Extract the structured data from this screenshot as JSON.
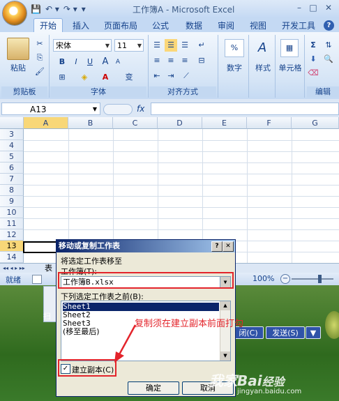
{
  "window": {
    "title": "工作簿A - Microsoft Excel",
    "min": "–",
    "max": "□",
    "close": "✕"
  },
  "qat": {
    "save": "💾",
    "undo": "↶ ▾",
    "redo": "↷ ▾",
    "more": "▾"
  },
  "tabs": [
    {
      "label": "开始",
      "active": true
    },
    {
      "label": "插入"
    },
    {
      "label": "页面布局"
    },
    {
      "label": "公式"
    },
    {
      "label": "数据"
    },
    {
      "label": "审阅"
    },
    {
      "label": "视图"
    },
    {
      "label": "开发工具"
    }
  ],
  "ribbon": {
    "clipboard": {
      "paste": "粘贴",
      "group": "剪贴板"
    },
    "font": {
      "name": "宋体",
      "size": "11",
      "bold": "B",
      "italic": "I",
      "underline": "U",
      "wen": "变",
      "group": "字体",
      "increase": "A",
      "decrease": "A"
    },
    "alignment": {
      "group": "对齐方式"
    },
    "number": {
      "label": "数字",
      "percent": "%"
    },
    "styles": {
      "label": "样式",
      "icon": "A"
    },
    "cells": {
      "label": "单元格"
    },
    "editing": {
      "group": "编辑",
      "sigma": "Σ"
    }
  },
  "formula": {
    "namebox": "A13",
    "fx": "fx",
    "value": ""
  },
  "grid": {
    "columns": [
      "A",
      "B",
      "C",
      "D",
      "E",
      "F",
      "G"
    ],
    "rows": [
      "3",
      "4",
      "5",
      "6",
      "7",
      "8",
      "9",
      "10",
      "11",
      "12",
      "13",
      "14"
    ],
    "selected_row": "13"
  },
  "sheetbar": {
    "nav": "◂◂ ◂ ▸ ▸▸",
    "partial_tab": "表"
  },
  "statusbar": {
    "ready": "就绪",
    "zoom": "100%",
    "zoom_minus": "−",
    "zoom_plus": "+"
  },
  "dialog": {
    "title": "移动或复制工作表",
    "help": "?",
    "close": "✕",
    "move_to": "将选定工作表移至",
    "book_label": "工作簿(T):",
    "book_value": "工作簿B.xlsx",
    "before_label": "下列选定工作表之前(B):",
    "sheets": [
      "Sheet1",
      "Sheet2",
      "Sheet3",
      "(移至最后)"
    ],
    "selected_sheet": "Sheet1",
    "copy_label": "建立副本(C)",
    "copy_checked": "✓",
    "ok": "确定",
    "cancel": "取消"
  },
  "annotation": "复制须在建立副本前面打勾",
  "background": {
    "btn_close": "闭(C)",
    "btn_send": "发送(S)",
    "partial_left": "扫"
  },
  "watermark": {
    "brand": "Bai",
    "brand2": "经验",
    "url": "jingyan.baidu.com",
    "left": "我家"
  },
  "colors": {
    "annotation": "#e3242b",
    "dialog_title": "#0a246a"
  }
}
